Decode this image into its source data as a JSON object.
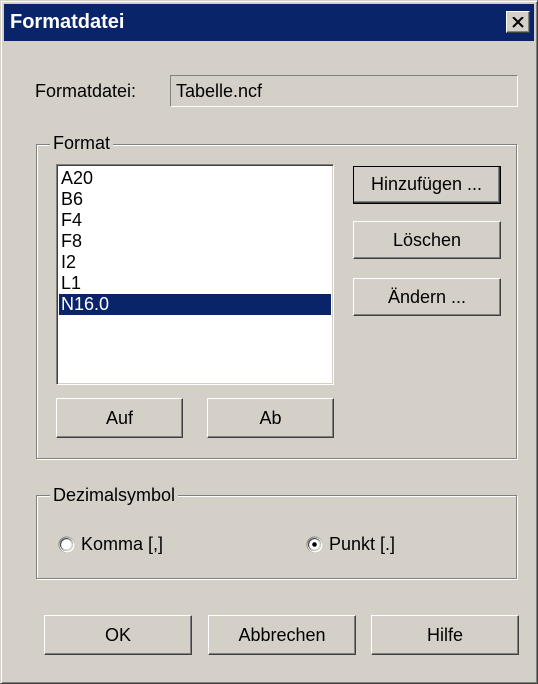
{
  "window": {
    "title": "Formatdatei",
    "close_icon": "close-icon"
  },
  "file": {
    "label": "Formatdatei:",
    "value": "Tabelle.ncf"
  },
  "format_group": {
    "legend": "Format",
    "items": [
      "A20",
      "B6",
      "F4",
      "F8",
      "I2",
      "L1",
      "N16.0"
    ],
    "selected": "N16.0",
    "add_label": "Hinzufügen ...",
    "delete_label": "Löschen",
    "edit_label": "Ändern ...",
    "up_label": "Auf",
    "down_label": "Ab"
  },
  "decimal_group": {
    "legend": "Dezimalsymbol",
    "comma_label": "Komma [,]",
    "point_label": "Punkt [.]",
    "selected": "point"
  },
  "footer": {
    "ok_label": "OK",
    "cancel_label": "Abbrechen",
    "help_label": "Hilfe"
  },
  "colors": {
    "titlebar": "#0a246a",
    "face": "#d4d0c8",
    "selection": "#0a246a"
  }
}
